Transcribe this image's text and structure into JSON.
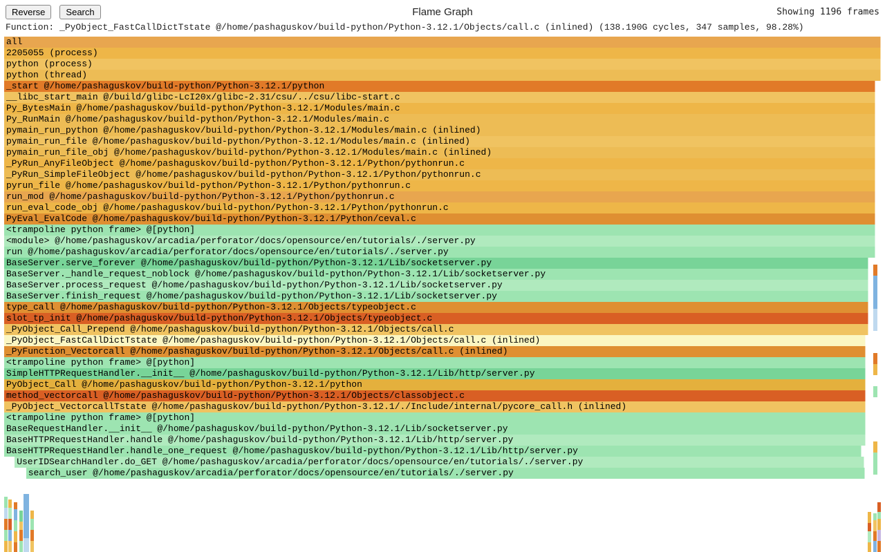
{
  "header": {
    "reverse_btn": "Reverse",
    "search_btn": "Search",
    "title": "Flame Graph",
    "frame_count": "Showing 1196 frames"
  },
  "function_line": "Function: _PyObject_FastCallDictTstate @/home/pashaguskov/build-python/Python-3.12.1/Objects/call.c (inlined) (138.190G cycles, 347 samples, 98.28%)",
  "chart_data": {
    "type": "flamegraph",
    "title": "Flame Graph",
    "unit": "cycles",
    "total_frames": 1196,
    "highlighted": {
      "name": "_PyObject_FastCallDictTstate",
      "location": "/home/pashaguskov/build-python/Python-3.12.1/Objects/call.c",
      "inlined": true,
      "cycles": 138190000000,
      "samples": 347,
      "percent": 98.28
    },
    "frames": [
      {
        "depth": 0,
        "label": "all",
        "width_pct": 100.0,
        "color": "orange-md"
      },
      {
        "depth": 1,
        "label": "2205055 (process)",
        "width_pct": 100.0,
        "color": "gold"
      },
      {
        "depth": 2,
        "label": "python (process)",
        "width_pct": 100.0,
        "color": "gold-lt"
      },
      {
        "depth": 3,
        "label": "python (thread)",
        "width_pct": 100.0,
        "color": "gold-md"
      },
      {
        "depth": 4,
        "label": "_start @/home/pashaguskov/build-python/Python-3.12.1/python",
        "width_pct": 99.4,
        "color": "orange"
      },
      {
        "depth": 5,
        "label": "__libc_start_main @/build/glibc-LcI20x/glibc-2.31/csu/../csu/libc-start.c",
        "width_pct": 99.4,
        "color": "gold-lt"
      },
      {
        "depth": 6,
        "label": "Py_BytesMain @/home/pashaguskov/build-python/Python-3.12.1/Modules/main.c",
        "width_pct": 99.4,
        "color": "gold"
      },
      {
        "depth": 7,
        "label": "Py_RunMain @/home/pashaguskov/build-python/Python-3.12.1/Modules/main.c",
        "width_pct": 99.4,
        "color": "gold-md"
      },
      {
        "depth": 8,
        "label": "pymain_run_python @/home/pashaguskov/build-python/Python-3.12.1/Modules/main.c (inlined)",
        "width_pct": 99.4,
        "color": "gold-md"
      },
      {
        "depth": 9,
        "label": "pymain_run_file @/home/pashaguskov/build-python/Python-3.12.1/Modules/main.c (inlined)",
        "width_pct": 99.4,
        "color": "gold-lt"
      },
      {
        "depth": 10,
        "label": "pymain_run_file_obj @/home/pashaguskov/build-python/Python-3.12.1/Modules/main.c (inlined)",
        "width_pct": 99.4,
        "color": "gold-md"
      },
      {
        "depth": 11,
        "label": "_PyRun_AnyFileObject @/home/pashaguskov/build-python/Python-3.12.1/Python/pythonrun.c",
        "width_pct": 99.4,
        "color": "gold"
      },
      {
        "depth": 12,
        "label": "_PyRun_SimpleFileObject @/home/pashaguskov/build-python/Python-3.12.1/Python/pythonrun.c",
        "width_pct": 99.4,
        "color": "gold-md"
      },
      {
        "depth": 13,
        "label": "pyrun_file @/home/pashaguskov/build-python/Python-3.12.1/Python/pythonrun.c",
        "width_pct": 99.4,
        "color": "gold"
      },
      {
        "depth": 14,
        "label": "run_mod @/home/pashaguskov/build-python/Python-3.12.1/Python/pythonrun.c",
        "width_pct": 99.4,
        "color": "orange-md"
      },
      {
        "depth": 15,
        "label": "run_eval_code_obj @/home/pashaguskov/build-python/Python-3.12.1/Python/pythonrun.c",
        "width_pct": 99.4,
        "color": "gold"
      },
      {
        "depth": 16,
        "label": "PyEval_EvalCode @/home/pashaguskov/build-python/Python-3.12.1/Python/ceval.c",
        "width_pct": 99.4,
        "color": "amber"
      },
      {
        "depth": 17,
        "label": "<trampoline python frame> @[python]",
        "width_pct": 99.4,
        "color": "mint"
      },
      {
        "depth": 18,
        "label": "<module> @/home/pashaguskov/arcadia/perforator/docs/opensource/en/tutorials/./server.py",
        "width_pct": 99.4,
        "color": "mint-lt"
      },
      {
        "depth": 19,
        "label": "run @/home/pashaguskov/arcadia/perforator/docs/opensource/en/tutorials/./server.py",
        "width_pct": 99.4,
        "color": "mint"
      },
      {
        "depth": 20,
        "label": "BaseServer.serve_forever @/home/pashaguskov/build-python/Python-3.12.1/Lib/socketserver.py",
        "width_pct": 98.6,
        "color": "mint-dk"
      },
      {
        "depth": 21,
        "label": "BaseServer._handle_request_noblock @/home/pashaguskov/build-python/Python-3.12.1/Lib/socketserver.py",
        "width_pct": 98.6,
        "color": "mint"
      },
      {
        "depth": 22,
        "label": "BaseServer.process_request @/home/pashaguskov/build-python/Python-3.12.1/Lib/socketserver.py",
        "width_pct": 98.6,
        "color": "mint-lt"
      },
      {
        "depth": 23,
        "label": "BaseServer.finish_request @/home/pashaguskov/build-python/Python-3.12.1/Lib/socketserver.py",
        "width_pct": 98.6,
        "color": "mint"
      },
      {
        "depth": 24,
        "label": "type_call @/home/pashaguskov/build-python/Python-3.12.1/Objects/typeobject.c",
        "width_pct": 98.6,
        "color": "amber"
      },
      {
        "depth": 25,
        "label": "slot_tp_init @/home/pashaguskov/build-python/Python-3.12.1/Objects/typeobject.c",
        "width_pct": 98.6,
        "color": "orange-dk"
      },
      {
        "depth": 26,
        "label": "_PyObject_Call_Prepend @/home/pashaguskov/build-python/Python-3.12.1/Objects/call.c",
        "width_pct": 98.6,
        "color": "gold-lt"
      },
      {
        "depth": 27,
        "label": "_PyObject_FastCallDictTstate @/home/pashaguskov/build-python/Python-3.12.1/Objects/call.c (inlined)",
        "width_pct": 98.28,
        "color": "cream",
        "highlighted": true
      },
      {
        "depth": 28,
        "label": "_PyFunction_Vectorcall @/home/pashaguskov/build-python/Python-3.12.1/Objects/call.c (inlined)",
        "width_pct": 98.28,
        "color": "amber"
      },
      {
        "depth": 29,
        "label": "<trampoline python frame> @[python]",
        "width_pct": 98.28,
        "color": "mint"
      },
      {
        "depth": 30,
        "label": "SimpleHTTPRequestHandler.__init__ @/home/pashaguskov/build-python/Python-3.12.1/Lib/http/server.py",
        "width_pct": 98.28,
        "color": "mint-dk"
      },
      {
        "depth": 31,
        "label": "PyObject_Call @/home/pashaguskov/build-python/Python-3.12.1/python",
        "width_pct": 98.28,
        "color": "yellow-dk"
      },
      {
        "depth": 32,
        "label": "method_vectorcall @/home/pashaguskov/build-python/Python-3.12.1/Objects/classobject.c",
        "width_pct": 98.28,
        "color": "orange-dk"
      },
      {
        "depth": 33,
        "label": "_PyObject_VectorcallTstate @/home/pashaguskov/build-python/Python-3.12.1/./Include/internal/pycore_call.h (inlined)",
        "width_pct": 98.28,
        "color": "gold-lt"
      },
      {
        "depth": 34,
        "label": "<trampoline python frame> @[python]",
        "width_pct": 98.28,
        "color": "mint"
      },
      {
        "depth": 35,
        "label": "BaseRequestHandler.__init__ @/home/pashaguskov/build-python/Python-3.12.1/Lib/socketserver.py",
        "width_pct": 98.28,
        "color": "mint"
      },
      {
        "depth": 36,
        "label": "BaseHTTPRequestHandler.handle @/home/pashaguskov/build-python/Python-3.12.1/Lib/http/server.py",
        "width_pct": 98.28,
        "color": "mint-lt"
      },
      {
        "depth": 37,
        "label": "BaseHTTPRequestHandler.handle_one_request @/home/pashaguskov/build-python/Python-3.12.1/Lib/http/server.py",
        "width_pct": 97.8,
        "color": "mint"
      },
      {
        "depth": 38,
        "label": "UserIDSearchHandler.do_GET @/home/pashaguskov/arcadia/perforator/docs/opensource/en/tutorials/./server.py",
        "width_pct": 96.9,
        "indent_pct": 1.2,
        "color": "mint-lt"
      },
      {
        "depth": 39,
        "label": "search_user @/home/pashaguskov/arcadia/perforator/docs/opensource/en/tutorials/./server.py",
        "width_pct": 95.7,
        "indent_pct": 2.5,
        "color": "mint"
      }
    ]
  }
}
